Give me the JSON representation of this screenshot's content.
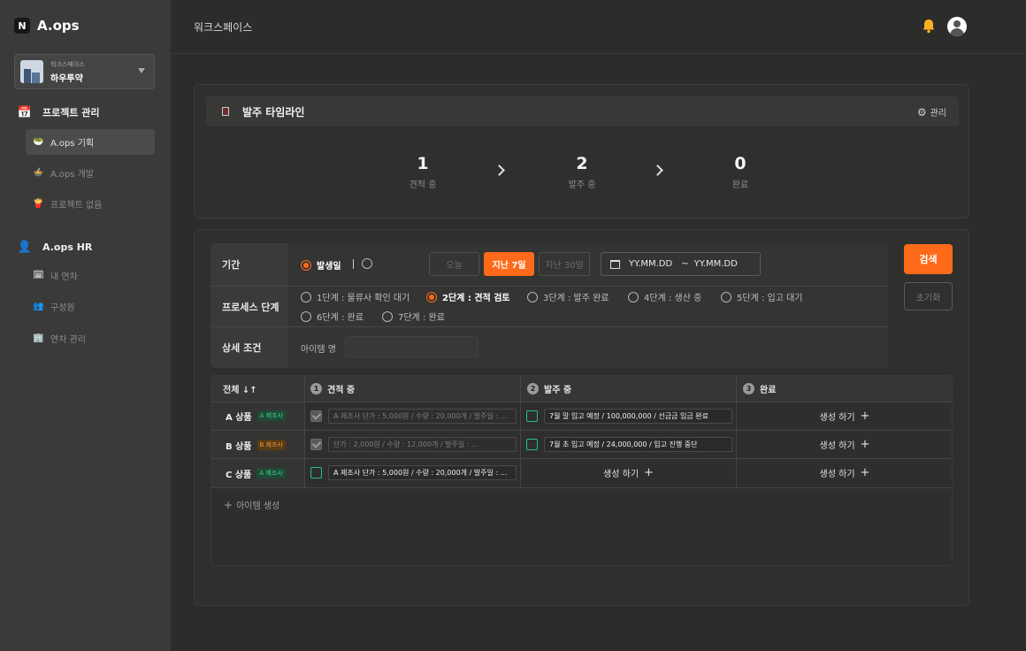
{
  "app": {
    "logo_mark": "N",
    "name": "A.ops"
  },
  "workspace": {
    "sub": "워크스페이스",
    "name": "하우투약"
  },
  "sidebar": {
    "groups": [
      {
        "label": "프로젝트 관리",
        "icon": "calendar-icon",
        "items": [
          {
            "label": "A.ops 기획",
            "icon": "green-bowl-icon",
            "active": true
          },
          {
            "label": "A.ops 개발",
            "icon": "yellow-bowl-icon",
            "active": false
          },
          {
            "label": "프로젝트 없음",
            "icon": "red-cup-icon",
            "active": false
          }
        ]
      },
      {
        "label": "A.ops HR",
        "icon": "person-icon",
        "items": [
          {
            "label": "내 연차",
            "icon": "calendar-small-icon"
          },
          {
            "label": "구성원",
            "icon": "people-icon"
          },
          {
            "label": "연차 관리",
            "icon": "building-icon"
          }
        ]
      }
    ]
  },
  "header": {
    "title": "워크스페이스"
  },
  "timeline": {
    "title": "발주 타임라인",
    "manage_label": "관리",
    "stats": [
      {
        "value": "1",
        "label": "견적 중"
      },
      {
        "value": "2",
        "label": "발주 중"
      },
      {
        "value": "0",
        "label": "완료"
      }
    ]
  },
  "filter": {
    "period_label": "기간",
    "period_radio_1": "발생일",
    "quick": [
      "오늘",
      "지난 7일",
      "지난 30일"
    ],
    "quick_selected": "지난 7일",
    "date_start": "YY.MM.DD",
    "date_sep": "~",
    "date_end": "YY.MM.DD",
    "process_label": "프로세스 단계",
    "stages": [
      "1단계 : 물류사 확인 대기",
      "2단계 : 견적 검토",
      "3단계 : 발주 완료",
      "4단계 : 생산 중",
      "5단계 : 입고 대기",
      "6단계 : 완료",
      "7단계 : 완료"
    ],
    "stage_selected": "2단계 : 견적 검토",
    "detail_label": "상세 조건",
    "item_label": "아이템 명",
    "item_value": ""
  },
  "buttons": {
    "search": "검색",
    "reset": "초기화"
  },
  "table": {
    "col_all": "전체 ↓↑",
    "columns": [
      {
        "num": "1",
        "label": "견적 중"
      },
      {
        "num": "2",
        "label": "발주 중"
      },
      {
        "num": "3",
        "label": "완료"
      }
    ],
    "rows": [
      {
        "name": "A 상품",
        "tag": "A 제조사",
        "tag_color": "#3ed08a",
        "c1": "A 제조사 단가 : 5,000원 / 수량 : 20,000개 / 발주일 : ...",
        "c1_state": "done",
        "c2": "7월 말 입고 예정 / 100,000,000 / 선금금 입금 완료",
        "c2_state": "todo",
        "c3": "생성 하기"
      },
      {
        "name": "B 상품",
        "tag": "B 제조사",
        "tag_color": "#e89a3c",
        "c1": "단가 : 2,000원 / 수량 : 12,000개 / 발주일 : ...",
        "c1_state": "done",
        "c2": "7월 초 입고 예정 / 24,000,000 / 입고 진행 중단",
        "c2_state": "todo",
        "c3": "생성 하기"
      },
      {
        "name": "C 상품",
        "tag": "A 제조사",
        "tag_color": "#3ed08a",
        "c1": "A 제조사 단가 : 5,000원 / 수량 : 20,000개 / 발주일 : ...",
        "c1_state": "todo",
        "c2": "생성 하기",
        "c3": "생성 하기"
      }
    ],
    "add_label": "아이템 생성"
  },
  "colors": {
    "accent": "#ff6a1a",
    "check": "#22c28a"
  }
}
